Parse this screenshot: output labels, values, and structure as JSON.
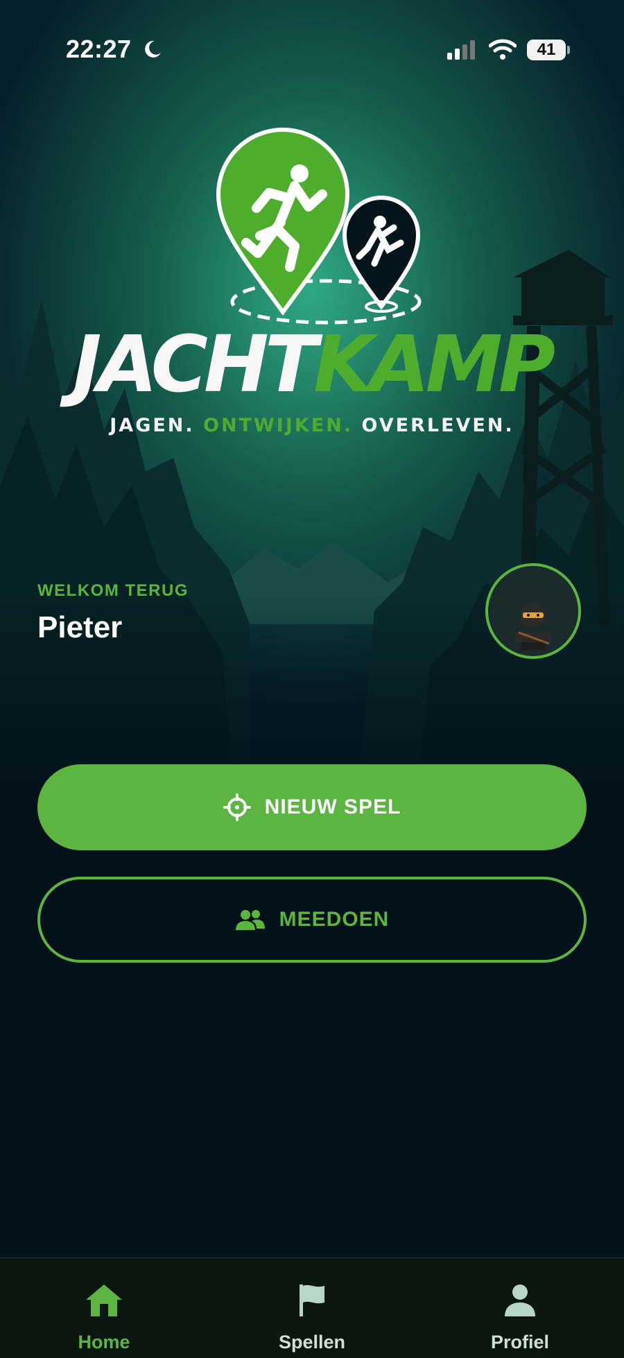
{
  "status": {
    "time": "22:27",
    "battery": "41"
  },
  "logo": {
    "word_white": "JACHT",
    "word_green": "KAMP",
    "tag_1": "JAGEN.",
    "tag_2": "ONTWIJKEN.",
    "tag_3": "OVERLEVEN."
  },
  "welcome": {
    "label": "WELKOM TERUG",
    "name": "Pieter",
    "avatar_icon": "ninja-avatar-icon"
  },
  "actions": {
    "new_game": {
      "label": "NIEUW SPEL",
      "icon": "crosshair-icon"
    },
    "join": {
      "label": "MEEDOEN",
      "icon": "people-icon"
    }
  },
  "tabs": [
    {
      "label": "Home",
      "icon": "home-icon",
      "active": true
    },
    {
      "label": "Spellen",
      "icon": "flag-icon",
      "active": false
    },
    {
      "label": "Profiel",
      "icon": "person-icon",
      "active": false
    }
  ],
  "colors": {
    "accent": "#5cb540",
    "background": "#03111a",
    "tabbar": "#0a160f"
  }
}
